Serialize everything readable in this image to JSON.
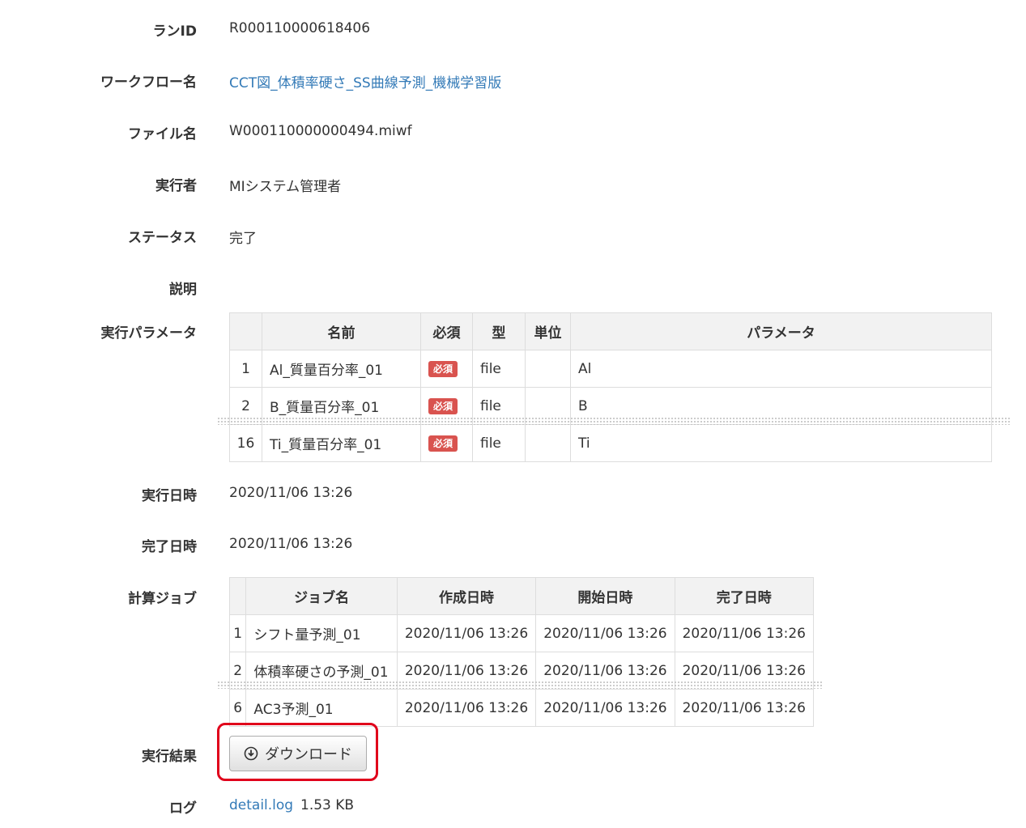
{
  "labels": {
    "run_id": "ランID",
    "workflow_name": "ワークフロー名",
    "file_name": "ファイル名",
    "executor": "実行者",
    "status": "ステータス",
    "description": "説明",
    "parameters": "実行パラメータ",
    "exec_datetime": "実行日時",
    "finish_datetime": "完了日時",
    "jobs": "計算ジョブ",
    "result": "実行結果",
    "log": "ログ"
  },
  "values": {
    "run_id": "R000110000618406",
    "workflow_name": "CCT図_体積率硬さ_SS曲線予測_機械学習版",
    "file_name": "W000110000000494.miwf",
    "executor": "MIシステム管理者",
    "status": "完了",
    "description": "",
    "exec_datetime": "2020/11/06 13:26",
    "finish_datetime": "2020/11/06 13:26"
  },
  "param_table": {
    "headers": [
      "",
      "名前",
      "必須",
      "型",
      "単位",
      "パラメータ"
    ],
    "rows": [
      {
        "no": "1",
        "name": "Al_質量百分率_01",
        "required": "必須",
        "type": "file",
        "unit": "",
        "param": "Al"
      },
      {
        "no": "2",
        "name": "B_質量百分率_01",
        "required": "必須",
        "type": "file",
        "unit": "",
        "param": "B"
      },
      {
        "no": "16",
        "name": "Ti_質量百分率_01",
        "required": "必須",
        "type": "file",
        "unit": "",
        "param": "Ti"
      }
    ]
  },
  "job_table": {
    "headers": [
      "",
      "ジョブ名",
      "作成日時",
      "開始日時",
      "完了日時"
    ],
    "rows": [
      {
        "no": "1",
        "name": "シフト量予測_01",
        "created": "2020/11/06 13:26",
        "started": "2020/11/06 13:26",
        "finished": "2020/11/06 13:26"
      },
      {
        "no": "2",
        "name": "体積率硬さの予測_01",
        "created": "2020/11/06 13:26",
        "started": "2020/11/06 13:26",
        "finished": "2020/11/06 13:26"
      },
      {
        "no": "6",
        "name": "AC3予測_01",
        "created": "2020/11/06 13:26",
        "started": "2020/11/06 13:26",
        "finished": "2020/11/06 13:26"
      }
    ]
  },
  "download_button": {
    "label": "ダウンロード",
    "icon": "download-circle-icon"
  },
  "log": {
    "file": "detail.log",
    "size": "1.53 KB"
  },
  "colors": {
    "link": "#337ab7",
    "badge": "#d9534f",
    "highlight": "#e0001b"
  }
}
